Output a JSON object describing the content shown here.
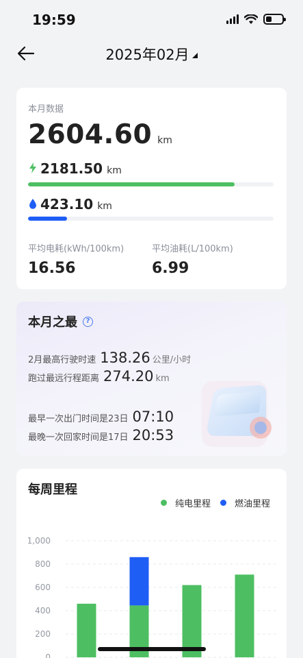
{
  "status": {
    "time": "19:59",
    "battery_level": 0.35
  },
  "nav": {
    "title": "2025年02月"
  },
  "monthly": {
    "label": "本月数据",
    "total_value": "2604.60",
    "total_unit": "km",
    "electric_value": "2181.50",
    "electric_unit": "km",
    "electric_fraction": 0.84,
    "fuel_value": "423.10",
    "fuel_unit": "km",
    "fuel_fraction": 0.16,
    "avg_power_label": "平均电耗(kWh/100km)",
    "avg_power_value": "16.56",
    "avg_fuel_label": "平均油耗(L/100km)",
    "avg_fuel_value": "6.99"
  },
  "best": {
    "title": "本月之最",
    "help_symbol": "?",
    "top_speed_label": "2月最高行驶时速",
    "top_speed_value": "138.26",
    "top_speed_unit": "公里/小时",
    "longest_label": "跑过最远行程距离",
    "longest_value": "274.20",
    "longest_unit": "km",
    "earliest_label": "最早一次出门时间是23日",
    "earliest_value": "07:10",
    "latest_label": "最晚一次回家时间是17日",
    "latest_value": "20:53"
  },
  "weekly": {
    "title": "每周里程"
  },
  "colors": {
    "electric": "#4dbf62",
    "fuel": "#1f5ef5",
    "accent_blue": "#4a7bf0"
  },
  "chart_data": {
    "type": "bar",
    "stacked": true,
    "categories": [
      "",
      "",
      "",
      ""
    ],
    "series": [
      {
        "name": "纯电里程",
        "values": [
          460,
          445,
          620,
          710
        ]
      },
      {
        "name": "燃油里程",
        "values": [
          0,
          415,
          0,
          0
        ]
      }
    ],
    "yticks": [
      "0",
      "200",
      "400",
      "600",
      "800",
      "1,000"
    ],
    "ylim": [
      0,
      1000
    ],
    "grid": true,
    "legend_position": "top-right"
  }
}
